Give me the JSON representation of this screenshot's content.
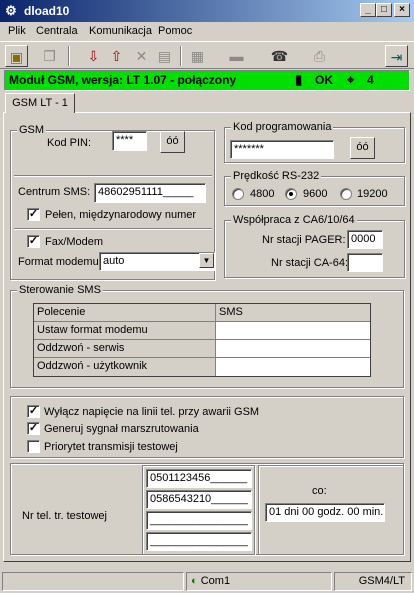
{
  "window": {
    "title": "dload10",
    "controls": {
      "minimize": "_",
      "maximize": "□",
      "close": "×"
    }
  },
  "menu": [
    {
      "label": "Plik",
      "underline": "P"
    },
    {
      "label": "Centrala",
      "underline": "C"
    },
    {
      "label": "Komunikacja",
      "underline": "K"
    },
    {
      "label": "Pomoc",
      "underline": "P"
    }
  ],
  "status": {
    "module_text": "Moduł GSM, wersja: LT 1.07 - połączony",
    "ok_text": "OK",
    "signal_level": "4",
    "color": "#00e000"
  },
  "tab": {
    "label": "GSM LT - 1"
  },
  "gsm": {
    "title": "GSM",
    "pin_label": "Kod PIN:",
    "pin_value": "****",
    "eye_label": "óó",
    "sms_center_label": "Centrum SMS:",
    "sms_center_value": "48602951111_____",
    "full_number_label": "Pełen, międzynarodowy numer",
    "full_number_checked": true,
    "fax_modem_label": "Fax/Modem",
    "fax_modem_checked": true,
    "modem_format_label": "Format modemu",
    "modem_format_value": "auto"
  },
  "programming": {
    "title": "Kod programowania",
    "value": "*******",
    "eye_label": "óó"
  },
  "rs232": {
    "title": "Prędkość RS-232",
    "options": [
      "4800",
      "9600",
      "19200"
    ],
    "selected": "9600"
  },
  "ca": {
    "title": "Współpraca z CA6/10/64",
    "pager_label": "Nr stacji PAGER:",
    "pager_value": "0000",
    "ca64_label": "Nr stacji CA-64:",
    "ca64_value": ""
  },
  "sms_control": {
    "title": "Sterowanie SMS",
    "columns": [
      "Polecenie",
      "SMS"
    ],
    "rows": [
      {
        "command": "Ustaw format modemu",
        "sms": ""
      },
      {
        "command": "Oddzwoń - serwis",
        "sms": ""
      },
      {
        "command": "Oddzwoń - użytkownik",
        "sms": ""
      }
    ]
  },
  "options": [
    {
      "label": "Wyłącz napięcie na linii tel. przy awarii GSM",
      "checked": true
    },
    {
      "label": "Generuj sygnał marszrutowania",
      "checked": true
    },
    {
      "label": "Priorytet transmisji testowej",
      "checked": false
    }
  ],
  "test": {
    "label": "Nr tel. tr. testowej",
    "numbers": [
      "0501123456______",
      "0586543210______",
      "________________",
      "________________"
    ],
    "every_label": "co:",
    "every_value": "01 dni 00 godz. 00 min."
  },
  "statusbar": {
    "port": "Com1",
    "device": "GSM4/LT"
  },
  "icons": {
    "toolbar": [
      "open-icon",
      "copy-icon",
      "read-icon",
      "write-icon",
      "delete-icon",
      "properties-icon",
      "calculator-icon",
      "eraser-icon",
      "modem-icon",
      "print-icon",
      "exit-icon"
    ]
  }
}
